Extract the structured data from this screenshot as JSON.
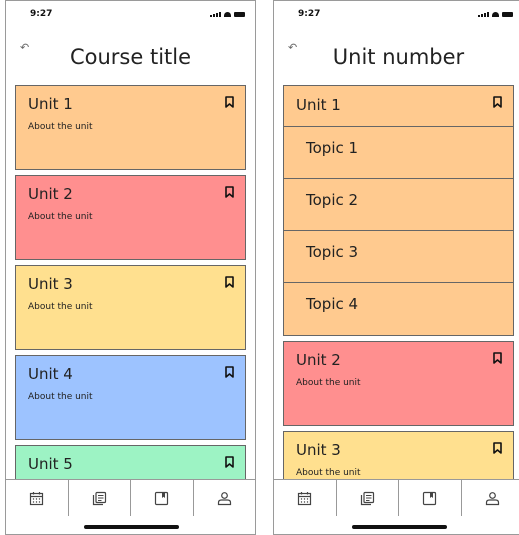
{
  "colors": {
    "orange": "#ffca8f",
    "red": "#ff8f8f",
    "yellow": "#ffe08f",
    "blue": "#9dc3ff",
    "green": "#9df3c4"
  },
  "left": {
    "status_time": "9:27",
    "title": "Course title",
    "back_icon": "back-arrow-icon",
    "units": [
      {
        "name": "Unit 1",
        "about": "About the unit",
        "color": "#ffca8f"
      },
      {
        "name": "Unit 2",
        "about": "About the unit",
        "color": "#ff8f8f"
      },
      {
        "name": "Unit 3",
        "about": "About the unit",
        "color": "#ffe08f"
      },
      {
        "name": "Unit 4",
        "about": "About the unit",
        "color": "#9dc3ff"
      },
      {
        "name": "Unit 5",
        "about": "",
        "color": "#9df3c4"
      }
    ]
  },
  "right": {
    "status_time": "9:27",
    "title": "Unit number",
    "expanded_unit": {
      "name": "Unit 1",
      "topics": [
        "Topic 1",
        "Topic 2",
        "Topic 3",
        "Topic 4"
      ]
    },
    "units": [
      {
        "name": "Unit 2",
        "about": "About the unit",
        "color": "#ff8f8f"
      },
      {
        "name": "Unit 3",
        "about": "About the unit",
        "color": "#ffe08f"
      }
    ]
  },
  "tabbar": {
    "icons": [
      "calendar-icon",
      "notes-icon",
      "bookmark-box-icon",
      "profile-icon"
    ]
  }
}
